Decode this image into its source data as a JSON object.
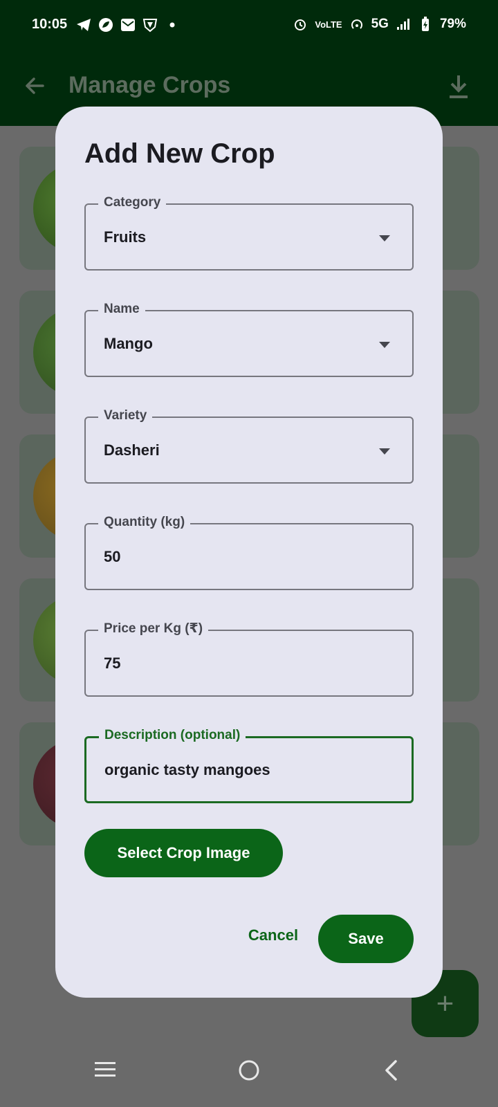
{
  "status_bar": {
    "time": "10:05",
    "network": "5G",
    "volte": "VoLTE",
    "battery": "79%",
    "left_icons": [
      "telegram-icon",
      "leaf-app-icon",
      "mail-icon",
      "shield-app-icon",
      "dot-icon"
    ],
    "right_icons": [
      "alarm-icon",
      "volte-icon",
      "hotspot-icon",
      "signal-icon",
      "battery-charging-icon"
    ]
  },
  "app_bar": {
    "title": "Manage Crops",
    "icons": [
      "back-arrow-icon",
      "download-icon"
    ]
  },
  "dialog": {
    "title": "Add New Crop",
    "fields": {
      "category": {
        "label": "Category",
        "value": "Fruits"
      },
      "name": {
        "label": "Name",
        "value": "Mango"
      },
      "variety": {
        "label": "Variety",
        "value": "Dasheri"
      },
      "quantity": {
        "label": "Quantity (kg)",
        "value": "50"
      },
      "price": {
        "label": "Price per Kg (₹)",
        "value": "75"
      },
      "description": {
        "label": "Description (optional)",
        "value": "organic tasty mangoes"
      }
    },
    "select_image_label": "Select Crop Image",
    "cancel_label": "Cancel",
    "save_label": "Save"
  },
  "fab": {
    "icon": "plus-icon",
    "symbol": "+"
  },
  "colors": {
    "app_bar": "#002a0b",
    "dialog_bg": "#e5e5f1",
    "primary": "#0b6518",
    "scrim": "#6b6b6b"
  }
}
